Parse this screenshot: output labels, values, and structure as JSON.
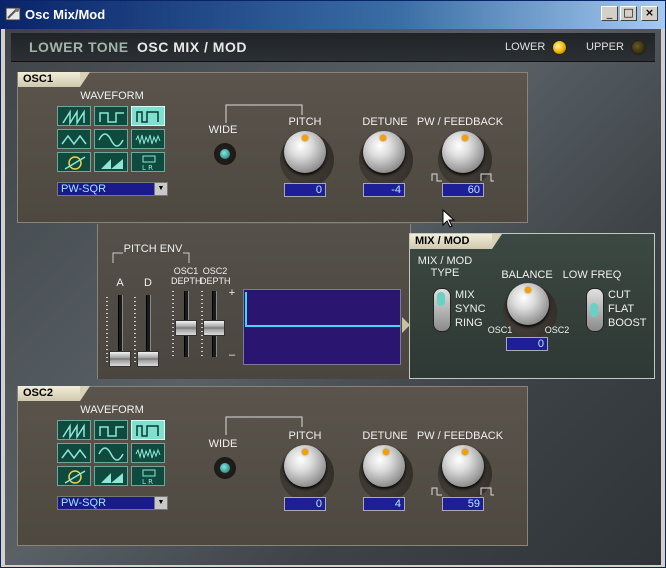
{
  "window": {
    "title": "Osc Mix/Mod",
    "minimize_glyph": "_",
    "maximize_glyph": "□",
    "close_glyph": "×"
  },
  "header": {
    "section": "LOWER TONE",
    "page": "OSC MIX / MOD",
    "lower_label": "LOWER",
    "upper_label": "UPPER",
    "lower_active": true,
    "upper_active": false
  },
  "colors": {
    "accent_knob": "#f4a000",
    "value_bg": "#1e1e96",
    "value_text": "#b8e8ff",
    "waveform_selected": "#7fe0d0"
  },
  "osc1": {
    "tab": "OSC1",
    "waveform_label": "WAVEFORM",
    "waveforms": [
      "saw",
      "square",
      "pw-square",
      "triangle",
      "sine",
      "noise",
      "feedback",
      "ramp",
      "ring-lr"
    ],
    "selected_waveform": "pw-square",
    "dropdown_value": "PW-SQR",
    "wide_label": "WIDE",
    "pitch_label": "PITCH",
    "pitch_value": "0",
    "detune_label": "DETUNE",
    "detune_value": "-4",
    "pw_label": "PW / FEEDBACK",
    "pw_value": "60"
  },
  "osc2": {
    "tab": "OSC2",
    "waveform_label": "WAVEFORM",
    "waveforms": [
      "saw",
      "square",
      "pw-square",
      "triangle",
      "sine",
      "noise",
      "feedback",
      "ramp",
      "ring-lr"
    ],
    "selected_waveform": "pw-square",
    "dropdown_value": "PW-SQR",
    "wide_label": "WIDE",
    "pitch_label": "PITCH",
    "pitch_value": "0",
    "detune_label": "DETUNE",
    "detune_value": "4",
    "pw_label": "PW / FEEDBACK",
    "pw_value": "59"
  },
  "pitch_env": {
    "title": "PITCH ENV",
    "a_label": "A",
    "d_label": "D",
    "osc1_depth_label_1": "OSC1",
    "osc1_depth_label_2": "DEPTH",
    "osc2_depth_label_1": "OSC2",
    "osc2_depth_label_2": "DEPTH",
    "plus": "+",
    "minus": "–"
  },
  "mix_mod": {
    "tab": "MIX / MOD",
    "type_label_1": "MIX / MOD",
    "type_label_2": "TYPE",
    "type_options": [
      "MIX",
      "SYNC",
      "RING"
    ],
    "balance_label": "BALANCE",
    "balance_left": "OSC1",
    "balance_right": "OSC2",
    "balance_value": "0",
    "lowfreq_label": "LOW FREQ",
    "lowfreq_options": [
      "CUT",
      "FLAT",
      "BOOST"
    ]
  }
}
